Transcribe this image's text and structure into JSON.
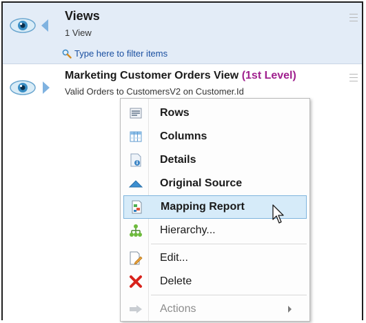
{
  "views_panel": {
    "title": "Views",
    "count": "1 View",
    "filter_placeholder": "Type here to filter items"
  },
  "view_item": {
    "title": "Marketing Customer Orders View",
    "level": "(1st Level)",
    "description": "Valid Orders to CustomersV2 on Customer.Id"
  },
  "context_menu": {
    "items": [
      {
        "label": "Rows",
        "icon": "rows-icon"
      },
      {
        "label": "Columns",
        "icon": "columns-icon"
      },
      {
        "label": "Details",
        "icon": "details-icon"
      },
      {
        "label": "Original Source",
        "icon": "original-source-icon"
      },
      {
        "label": "Mapping Report",
        "icon": "mapping-report-icon",
        "selected": true
      },
      {
        "label": "Hierarchy...",
        "icon": "hierarchy-icon"
      },
      {
        "label": "Edit...",
        "icon": "edit-icon"
      },
      {
        "label": "Delete",
        "icon": "delete-icon"
      },
      {
        "label": "Actions",
        "icon": "actions-icon",
        "disabled": true
      }
    ]
  },
  "colors": {
    "header_bg": "#e3ecf7",
    "selected_bg": "#d6ebf9",
    "level_accent": "#a0208e",
    "link": "#1a4fa0"
  }
}
